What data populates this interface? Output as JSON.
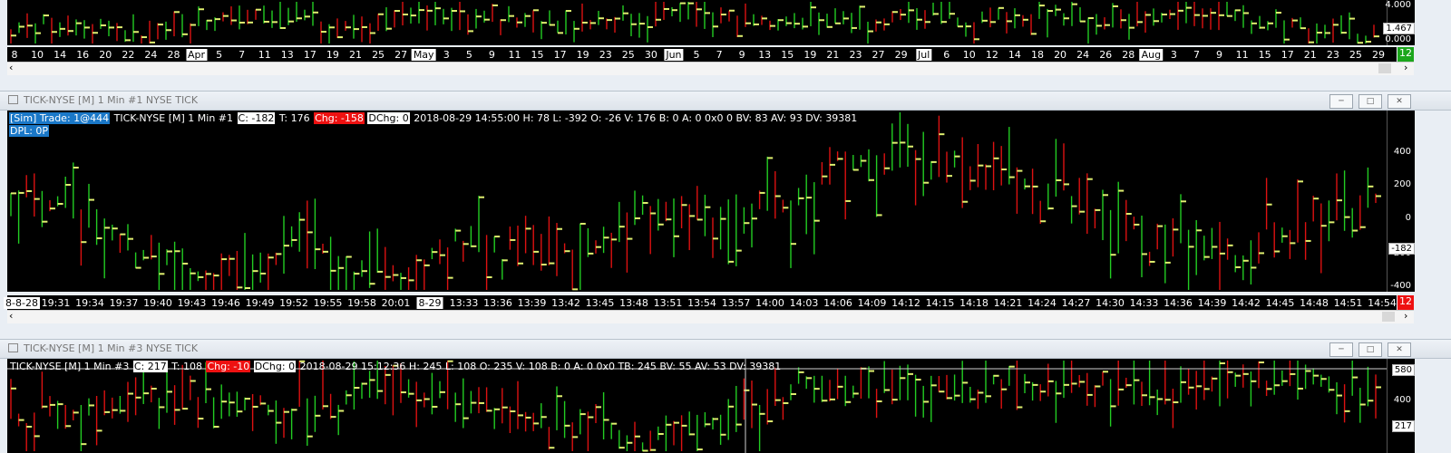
{
  "top_pane": {
    "price_labels": [
      "4.000",
      "0.000"
    ],
    "last_value": "1.467",
    "bars_digit": "12",
    "date_axis": [
      {
        "label": "8",
        "hl": false
      },
      {
        "label": "10",
        "hl": false
      },
      {
        "label": "14",
        "hl": false
      },
      {
        "label": "16",
        "hl": false
      },
      {
        "label": "20",
        "hl": false
      },
      {
        "label": "22",
        "hl": false
      },
      {
        "label": "24",
        "hl": false
      },
      {
        "label": "28",
        "hl": false
      },
      {
        "label": "Apr",
        "hl": true
      },
      {
        "label": "5",
        "hl": false
      },
      {
        "label": "7",
        "hl": false
      },
      {
        "label": "11",
        "hl": false
      },
      {
        "label": "13",
        "hl": false
      },
      {
        "label": "17",
        "hl": false
      },
      {
        "label": "19",
        "hl": false
      },
      {
        "label": "21",
        "hl": false
      },
      {
        "label": "25",
        "hl": false
      },
      {
        "label": "27",
        "hl": false
      },
      {
        "label": "May",
        "hl": true
      },
      {
        "label": "3",
        "hl": false
      },
      {
        "label": "5",
        "hl": false
      },
      {
        "label": "9",
        "hl": false
      },
      {
        "label": "11",
        "hl": false
      },
      {
        "label": "15",
        "hl": false
      },
      {
        "label": "17",
        "hl": false
      },
      {
        "label": "19",
        "hl": false
      },
      {
        "label": "23",
        "hl": false
      },
      {
        "label": "25",
        "hl": false
      },
      {
        "label": "30",
        "hl": false
      },
      {
        "label": "Jun",
        "hl": true
      },
      {
        "label": "5",
        "hl": false
      },
      {
        "label": "7",
        "hl": false
      },
      {
        "label": "9",
        "hl": false
      },
      {
        "label": "13",
        "hl": false
      },
      {
        "label": "15",
        "hl": false
      },
      {
        "label": "19",
        "hl": false
      },
      {
        "label": "21",
        "hl": false
      },
      {
        "label": "23",
        "hl": false
      },
      {
        "label": "27",
        "hl": false
      },
      {
        "label": "29",
        "hl": false
      },
      {
        "label": "Jul",
        "hl": true
      },
      {
        "label": "6",
        "hl": false
      },
      {
        "label": "10",
        "hl": false
      },
      {
        "label": "12",
        "hl": false
      },
      {
        "label": "14",
        "hl": false
      },
      {
        "label": "18",
        "hl": false
      },
      {
        "label": "20",
        "hl": false
      },
      {
        "label": "24",
        "hl": false
      },
      {
        "label": "26",
        "hl": false
      },
      {
        "label": "28",
        "hl": false
      },
      {
        "label": "Aug",
        "hl": true
      },
      {
        "label": "3",
        "hl": false
      },
      {
        "label": "7",
        "hl": false
      },
      {
        "label": "9",
        "hl": false
      },
      {
        "label": "11",
        "hl": false
      },
      {
        "label": "15",
        "hl": false
      },
      {
        "label": "17",
        "hl": false
      },
      {
        "label": "21",
        "hl": false
      },
      {
        "label": "23",
        "hl": false
      },
      {
        "label": "25",
        "hl": false
      },
      {
        "label": "29",
        "hl": false
      }
    ]
  },
  "mid_window": {
    "title": "TICK-NYSE [M]  1 Min   #1  NYSE TICK",
    "sim": "[Sim]  Trade: 1@444",
    "info_prefix": "TICK-NYSE [M]  1 Min   #1",
    "close": "C: -182",
    "total": "T: 176",
    "chg": "Chg: -158",
    "dchg": "DChg: 0",
    "info_rest": "2018-08-29 14:55:00 H: 78 L: -392 O: -26 V: 176 B: 0 A: 0 0x0 0 BV: 83 AV: 93 DV: 39381",
    "dpl": "DPL: 0P",
    "price_labels": [
      "400",
      "200",
      "0",
      "-200",
      "-400"
    ],
    "last_value": "-182",
    "bars_digit": "12",
    "time_axis": [
      {
        "label": "8-8-28",
        "hl": true
      },
      {
        "label": "19:31",
        "hl": false
      },
      {
        "label": "19:34",
        "hl": false
      },
      {
        "label": "19:37",
        "hl": false
      },
      {
        "label": "19:40",
        "hl": false
      },
      {
        "label": "19:43",
        "hl": false
      },
      {
        "label": "19:46",
        "hl": false
      },
      {
        "label": "19:49",
        "hl": false
      },
      {
        "label": "19:52",
        "hl": false
      },
      {
        "label": "19:55",
        "hl": false
      },
      {
        "label": "19:58",
        "hl": false
      },
      {
        "label": "20:01",
        "hl": false
      },
      {
        "label": "8-29",
        "hl": true
      },
      {
        "label": "13:33",
        "hl": false
      },
      {
        "label": "13:36",
        "hl": false
      },
      {
        "label": "13:39",
        "hl": false
      },
      {
        "label": "13:42",
        "hl": false
      },
      {
        "label": "13:45",
        "hl": false
      },
      {
        "label": "13:48",
        "hl": false
      },
      {
        "label": "13:51",
        "hl": false
      },
      {
        "label": "13:54",
        "hl": false
      },
      {
        "label": "13:57",
        "hl": false
      },
      {
        "label": "14:00",
        "hl": false
      },
      {
        "label": "14:03",
        "hl": false
      },
      {
        "label": "14:06",
        "hl": false
      },
      {
        "label": "14:09",
        "hl": false
      },
      {
        "label": "14:12",
        "hl": false
      },
      {
        "label": "14:15",
        "hl": false
      },
      {
        "label": "14:18",
        "hl": false
      },
      {
        "label": "14:21",
        "hl": false
      },
      {
        "label": "14:24",
        "hl": false
      },
      {
        "label": "14:27",
        "hl": false
      },
      {
        "label": "14:30",
        "hl": false
      },
      {
        "label": "14:33",
        "hl": false
      },
      {
        "label": "14:36",
        "hl": false
      },
      {
        "label": "14:39",
        "hl": false
      },
      {
        "label": "14:42",
        "hl": false
      },
      {
        "label": "14:45",
        "hl": false
      },
      {
        "label": "14:48",
        "hl": false
      },
      {
        "label": "14:51",
        "hl": false
      },
      {
        "label": "14:54",
        "hl": false
      }
    ]
  },
  "bottom_window": {
    "title": "TICK-NYSE [M]  1 Min   #3  NYSE TICK",
    "info_prefix": "TICK-NYSE [M]  1 Min   #3",
    "close": "C: 217",
    "total": "T: 108",
    "chg": "Chg: -10",
    "dchg": "DChg: 0",
    "info_rest": "2018-08-29 15:12:36 H: 245 L: 108 O: 235 V: 108 B: 0 A: 0 0x0 TB: 245 BV: 55 AV: 53 DV: 39381",
    "price_labels": [
      "400"
    ],
    "crosshair_value": "580",
    "last_value": "217"
  },
  "colors": {
    "up": "#22cc22",
    "down": "#dd1111",
    "close_tick": "#e0f070",
    "selected": "#1a78c8"
  }
}
